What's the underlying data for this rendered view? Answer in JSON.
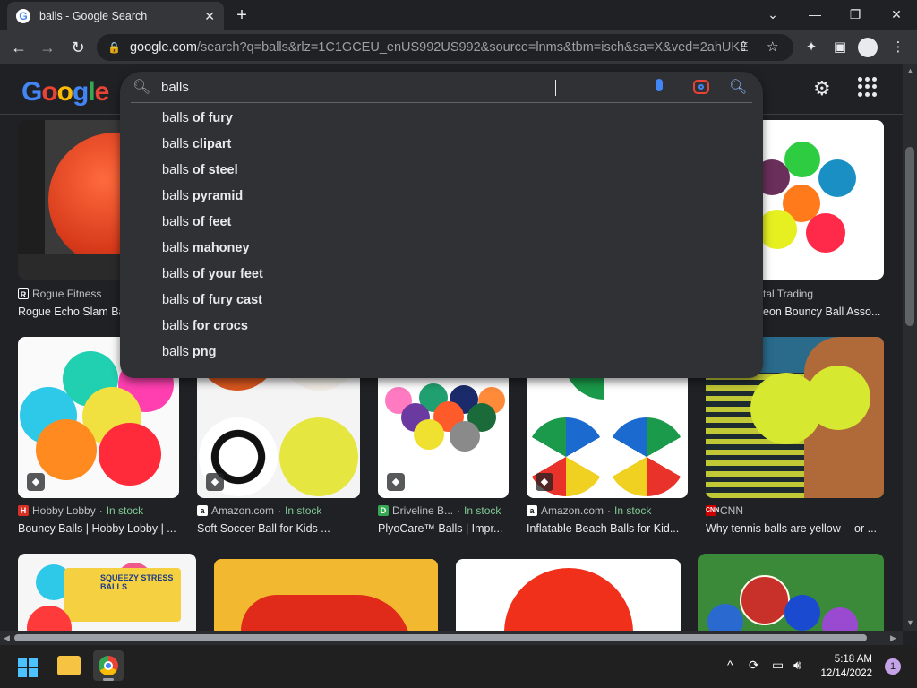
{
  "browser": {
    "tab_title": "balls - Google Search",
    "new_tab": "+",
    "url_host": "google.com",
    "url_rest": "/search?q=balls&rlz=1C1GCEU_enUS992US992&source=lnms&tbm=isch&sa=X&ved=2ahUKE..."
  },
  "search": {
    "query": "balls",
    "suggestion_prefix": "balls",
    "suggestions": [
      {
        "suffix": " of fury"
      },
      {
        "suffix": " clipart"
      },
      {
        "suffix": " of steel"
      },
      {
        "suffix": " pyramid"
      },
      {
        "suffix": " of feet"
      },
      {
        "suffix": " mahoney"
      },
      {
        "suffix": " of your feet"
      },
      {
        "suffix": " of fury cast"
      },
      {
        "suffix": " for crocs"
      },
      {
        "suffix": " png"
      }
    ]
  },
  "logo": {
    "letters": [
      "G",
      "o",
      "o",
      "g",
      "l",
      "e"
    ]
  },
  "results": {
    "row1": [
      {
        "source": "Rogue Fitness",
        "caption": "Rogue Echo Slam Ba"
      },
      {
        "source": "tal Trading",
        "caption": "eon Bouncy Ball Asso..."
      }
    ],
    "row2": [
      {
        "source": "Hobby Lobby",
        "stock": "In stock",
        "caption": "Bouncy Balls | Hobby Lobby | ..."
      },
      {
        "source": "Amazon.com",
        "stock": "In stock",
        "caption": "Soft Soccer Ball for Kids ..."
      },
      {
        "source": "Driveline B...",
        "stock": "In stock",
        "caption": "PlyoCare™ Balls | Impr..."
      },
      {
        "source": "Amazon.com",
        "stock": "In stock",
        "caption": "Inflatable Beach Balls for Kid..."
      },
      {
        "source": "CNN",
        "stock": "",
        "caption": "Why tennis balls are yellow -- or ..."
      }
    ],
    "stock_sep": " · ",
    "row3_label": "SQUEEZY STRESS BALLS"
  },
  "taskbar": {
    "time": "5:18 AM",
    "date": "12/14/2022",
    "notifications": "1"
  },
  "colors": {
    "accent": "#8ab4f8",
    "in_stock": "#81c995",
    "bg": "#202124"
  }
}
